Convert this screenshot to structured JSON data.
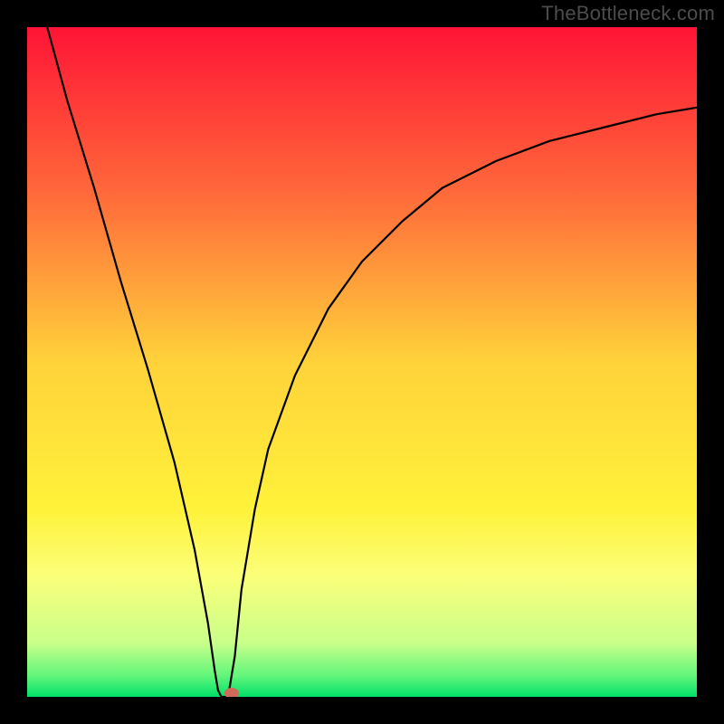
{
  "watermark": "TheBottleneck.com",
  "chart_data": {
    "type": "line",
    "title": "",
    "xlabel": "",
    "ylabel": "",
    "xlim": [
      0,
      100
    ],
    "ylim": [
      0,
      100
    ],
    "x": [
      3,
      6,
      10,
      14,
      18,
      22,
      25,
      27,
      28,
      28.5,
      29,
      30,
      31,
      32,
      34,
      36,
      40,
      45,
      50,
      56,
      62,
      70,
      78,
      86,
      94,
      100
    ],
    "values": [
      100,
      89,
      76,
      62,
      49,
      35,
      22,
      11,
      4,
      1,
      0,
      0,
      6,
      16,
      28,
      37,
      48,
      58,
      65,
      71,
      76,
      80,
      83,
      85,
      87,
      88
    ],
    "marker": {
      "x": 30.5,
      "y": 0.5
    },
    "background": {
      "gradient_stops": [
        {
          "pos": 0.0,
          "color": "#ff1436"
        },
        {
          "pos": 0.25,
          "color": "#ff6a3a"
        },
        {
          "pos": 0.5,
          "color": "#ffd23a"
        },
        {
          "pos": 0.72,
          "color": "#fff23a"
        },
        {
          "pos": 0.82,
          "color": "#fbff7a"
        },
        {
          "pos": 0.92,
          "color": "#c8ff8a"
        },
        {
          "pos": 0.97,
          "color": "#5ef57a"
        },
        {
          "pos": 1.0,
          "color": "#00e06a"
        }
      ]
    },
    "frame_color": "#000000"
  }
}
